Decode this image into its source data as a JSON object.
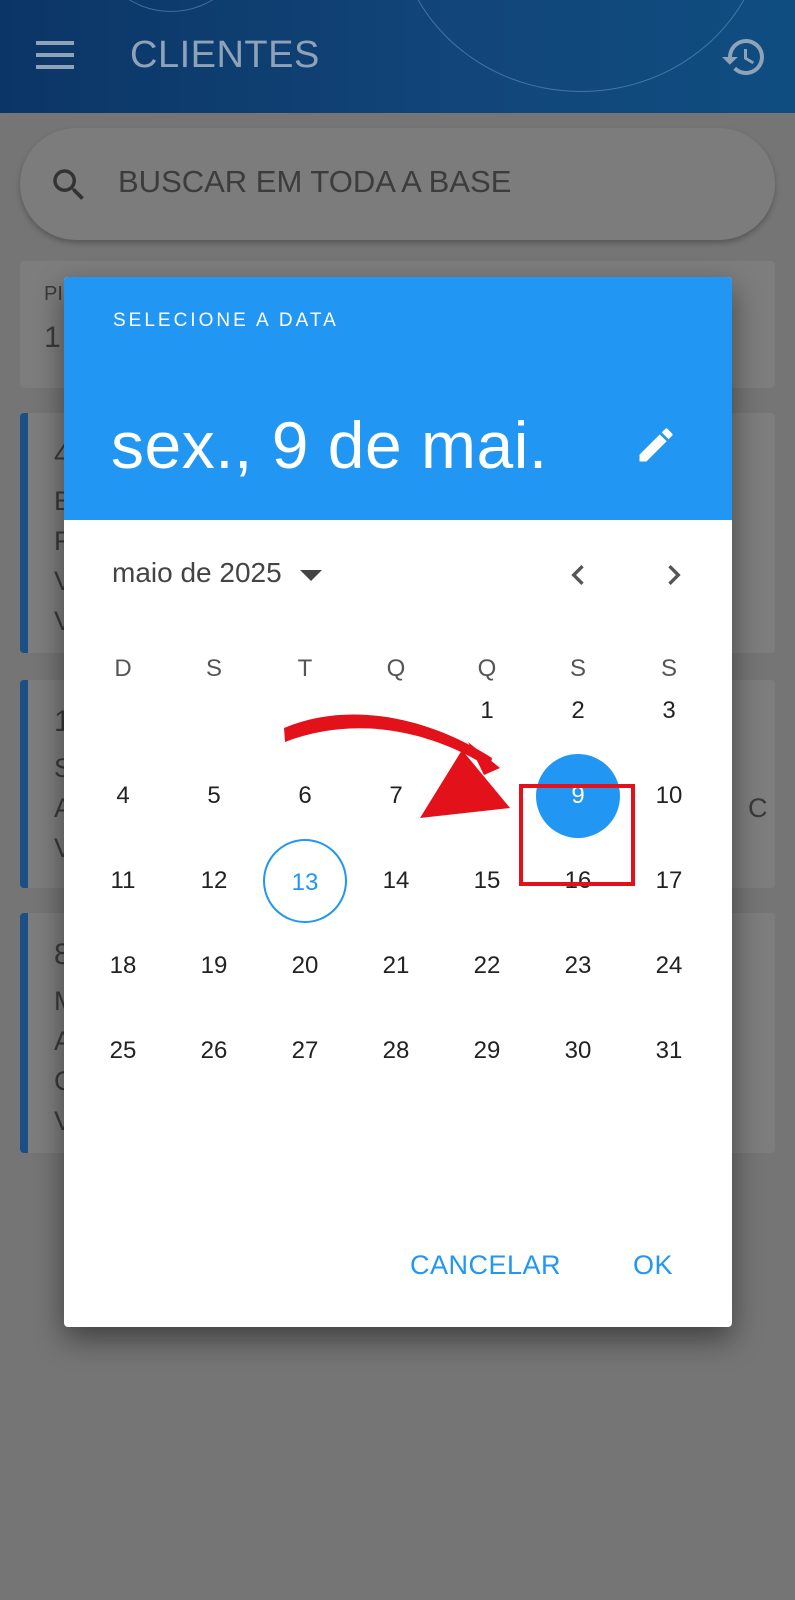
{
  "appbar": {
    "title": "CLIENTES",
    "menu_icon": "menu-icon",
    "history_icon": "history-icon"
  },
  "search": {
    "placeholder": "BUSCAR EM TODA A BASE",
    "icon": "search-icon"
  },
  "background_cards": [
    {
      "lines": [
        "PI",
        "1"
      ]
    },
    {
      "lines": [
        "4",
        "B",
        "F",
        "V",
        "V"
      ]
    },
    {
      "lines": [
        "1",
        "S",
        "A",
        "V"
      ],
      "right": "C"
    },
    {
      "lines": [
        "8",
        "M",
        "A",
        "C",
        "V"
      ]
    }
  ],
  "dialog": {
    "label": "SELECIONE A DATA",
    "selected_date_text": "sex., 9 de mai.",
    "month_label": "maio de 2025",
    "weekdays": [
      "D",
      "S",
      "T",
      "Q",
      "Q",
      "S",
      "S"
    ],
    "days": [
      "1",
      "2",
      "3",
      "4",
      "5",
      "6",
      "7",
      "8",
      "9",
      "10",
      "11",
      "12",
      "13",
      "14",
      "15",
      "16",
      "17",
      "18",
      "19",
      "20",
      "21",
      "22",
      "23",
      "24",
      "25",
      "26",
      "27",
      "28",
      "29",
      "30",
      "31"
    ],
    "first_weekday_index": 4,
    "today": "13",
    "selected": "9",
    "cancel_label": "CANCELAR",
    "ok_label": "OK"
  },
  "colors": {
    "accent": "#2196f3",
    "annotation": "#e3111a",
    "scrim": "#757575"
  }
}
